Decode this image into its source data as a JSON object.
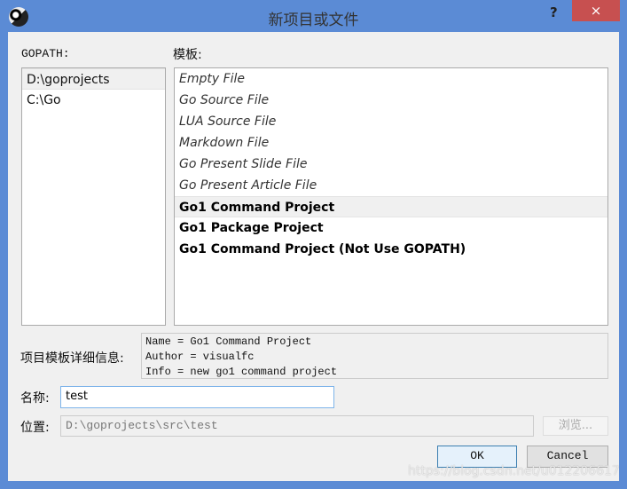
{
  "window": {
    "title": "新项目或文件",
    "help": "?",
    "close": "×"
  },
  "gopath": {
    "label": "GOPATH:",
    "items": [
      "D:\\goprojects",
      "C:\\Go"
    ],
    "selected": 0
  },
  "templates": {
    "label": "模板:",
    "items": [
      {
        "label": "Empty File",
        "style": "italic"
      },
      {
        "label": "Go Source File",
        "style": "italic"
      },
      {
        "label": "LUA Source File",
        "style": "italic"
      },
      {
        "label": "Markdown File",
        "style": "italic"
      },
      {
        "label": "Go Present Slide File",
        "style": "italic"
      },
      {
        "label": "Go Present Article File",
        "style": "italic"
      },
      {
        "label": "Go1 Command Project",
        "style": "bold"
      },
      {
        "label": "Go1 Package Project",
        "style": "bold"
      },
      {
        "label": "Go1 Command Project (Not Use GOPATH)",
        "style": "bold"
      }
    ],
    "selected": 6
  },
  "details": {
    "label": "项目模板详细信息:",
    "lines": [
      "Name = Go1 Command Project",
      "Author = visualfc",
      "Info = new go1 command project"
    ]
  },
  "name": {
    "label": "名称:",
    "value": "test"
  },
  "location": {
    "label": "位置:",
    "value": "D:\\goprojects\\src\\test",
    "browse": "浏览..."
  },
  "buttons": {
    "ok": "OK",
    "cancel": "Cancel"
  },
  "watermark": "https://blog.csdn.net/u012206617"
}
